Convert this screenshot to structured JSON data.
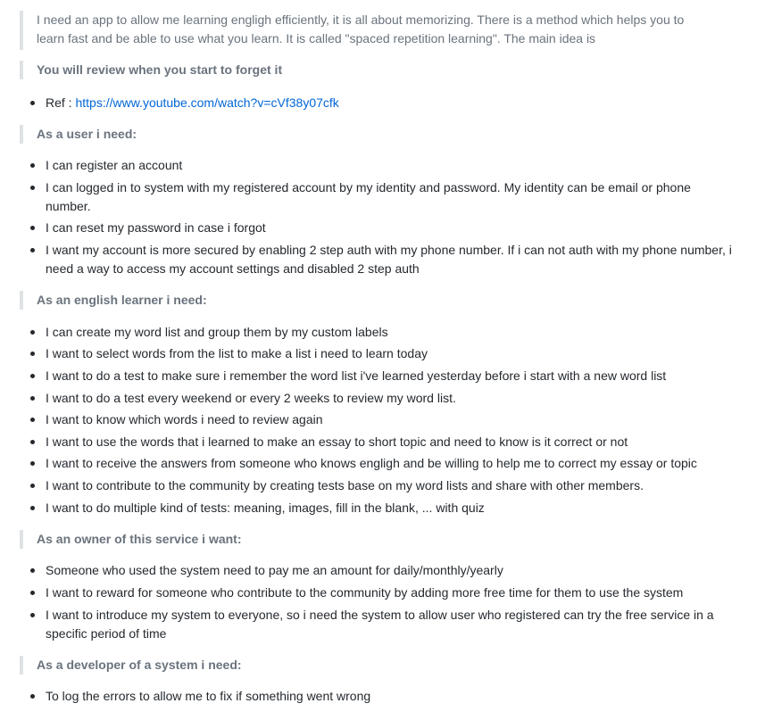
{
  "intro": "I need an app to allow me learning engligh efficiently, it is all about memorizing. There is a method which helps you to learn fast and be able to use what you learn. It is called \"spaced repetition learning\". The main idea is",
  "principle": "You will review when you start to forget it",
  "ref": {
    "label": "Ref : ",
    "url": "https://www.youtube.com/watch?v=cVf38y07cfk"
  },
  "sections": [
    {
      "heading": "As a user i need:",
      "items": [
        "I can register an account",
        "I can logged in to system with my registered account by my identity and password. My identity can be email or phone number.",
        "I can reset my password in case i forgot",
        "I want my account is more secured by enabling 2 step auth with my phone number. If i can not auth with my phone number, i need a way to access my account settings and disabled 2 step auth"
      ]
    },
    {
      "heading": "As an english learner i need:",
      "items": [
        "I can create my word list and group them by my custom labels",
        "I want to select words from the list to make a list i need to learn today",
        "I want to do a test to make sure i remember the word list i've learned yesterday before i start with a new word list",
        "I want to do a test every weekend or every 2 weeks to review my word list.",
        "I want to know which words i need to review again",
        "I want to use the words that i learned to make an essay to short topic and need to know is it correct or not",
        "I want to receive the answers from someone who knows engligh and be willing to help me to correct my essay or topic",
        "I want to contribute to the community by creating tests base on my word lists and share with other members.",
        "I want to do multiple kind of tests: meaning, images, fill in the blank, ... with quiz"
      ]
    },
    {
      "heading": "As an owner of this service i want:",
      "items": [
        "Someone who used the system need to pay me an amount for daily/monthly/yearly",
        "I want to reward for someone who contribute to the community by adding more free time for them to use the system",
        "I want to introduce my system to everyone, so i need the system to allow user who registered can try the free service in a specific period of time"
      ]
    },
    {
      "heading": "As a developer of a system i need:",
      "items": [
        "To log the errors to allow me to fix if something went wrong"
      ]
    }
  ]
}
